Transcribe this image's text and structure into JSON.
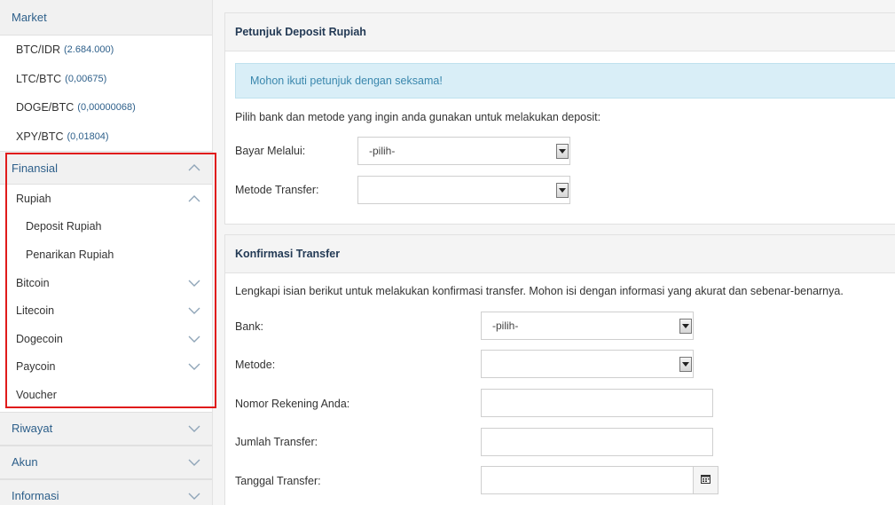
{
  "sidebar": {
    "market": {
      "title": "Market",
      "items": [
        {
          "pair": "BTC/IDR",
          "value": "(2.684.000)"
        },
        {
          "pair": "LTC/BTC",
          "value": "(0,00675)"
        },
        {
          "pair": "DOGE/BTC",
          "value": "(0,00000068)"
        },
        {
          "pair": "XPY/BTC",
          "value": "(0,01804)"
        }
      ]
    },
    "finansial": {
      "title": "Finansial",
      "rupiah": "Rupiah",
      "deposit": "Deposit Rupiah",
      "penarikan": "Penarikan Rupiah",
      "bitcoin": "Bitcoin",
      "litecoin": "Litecoin",
      "dogecoin": "Dogecoin",
      "paycoin": "Paycoin",
      "voucher": "Voucher"
    },
    "riwayat": "Riwayat",
    "akun": "Akun",
    "informasi": "Informasi"
  },
  "deposit_panel": {
    "title": "Petunjuk Deposit Rupiah",
    "alert": "Mohon ikuti petunjuk dengan seksama!",
    "instruction": "Pilih bank dan metode yang ingin anda gunakan untuk melakukan deposit:",
    "bayar_label": "Bayar Melalui:",
    "bayar_value": "-pilih-",
    "metode_label": "Metode Transfer:",
    "metode_value": ""
  },
  "konfirmasi_panel": {
    "title": "Konfirmasi Transfer",
    "instruction": "Lengkapi isian berikut untuk melakukan konfirmasi transfer. Mohon isi dengan informasi yang akurat dan sebenar-benarnya.",
    "bank_label": "Bank:",
    "bank_value": "-pilih-",
    "metode_label": "Metode:",
    "metode_value": "",
    "rekening_label": "Nomor Rekening Anda:",
    "jumlah_label": "Jumlah Transfer:",
    "tanggal_label": "Tanggal Transfer:"
  },
  "colors": {
    "link": "#2d5f8a",
    "highlight": "#e01b1b",
    "alert_bg": "#d9eef7",
    "alert_text": "#3a87ad"
  }
}
